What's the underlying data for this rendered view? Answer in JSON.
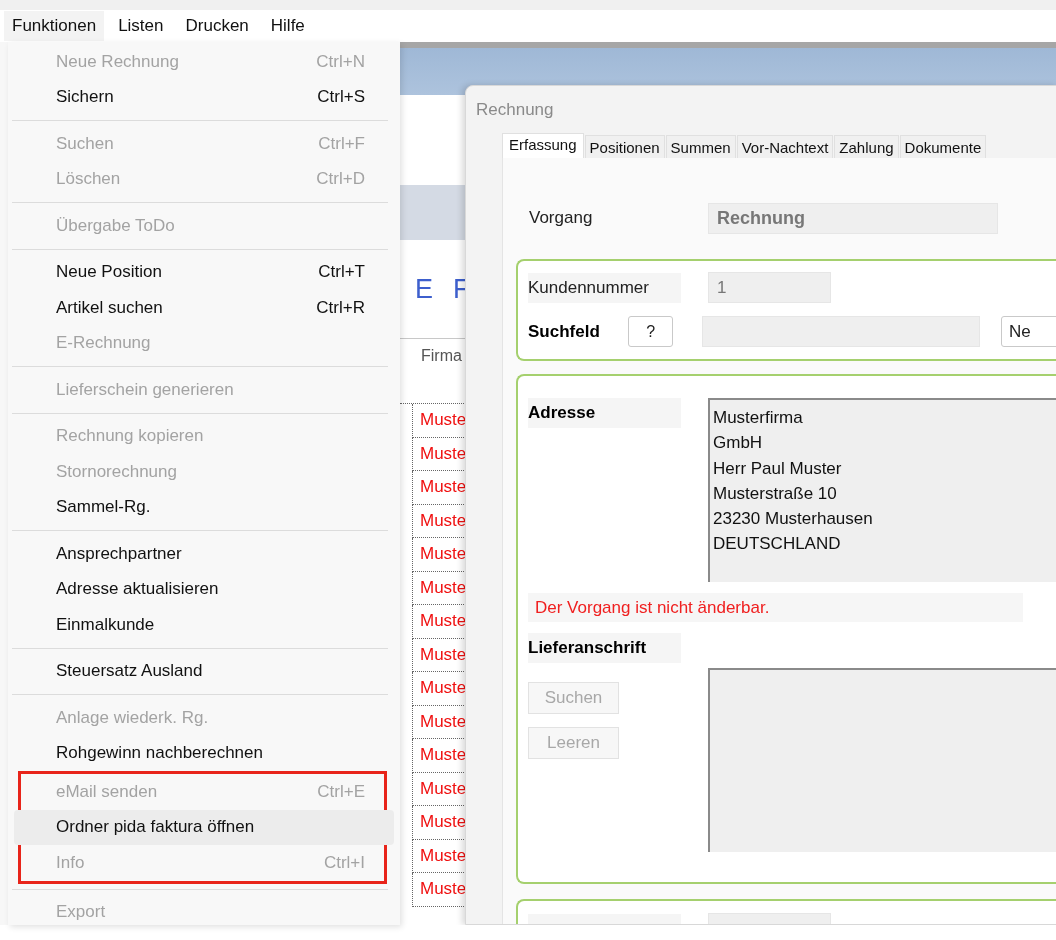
{
  "menubar": [
    {
      "label": "Funktionen",
      "selected": true
    },
    {
      "label": "Listen",
      "selected": false
    },
    {
      "label": "Drucken",
      "selected": false
    },
    {
      "label": "Hilfe",
      "selected": false
    }
  ],
  "menu": {
    "items": [
      {
        "kind": "item",
        "label": "Neue Rechnung",
        "shortcut": "Ctrl+N",
        "disabled": true,
        "selected": false,
        "framed": false
      },
      {
        "kind": "item",
        "label": "Sichern",
        "shortcut": "Ctrl+S",
        "disabled": false,
        "selected": false,
        "framed": false
      },
      {
        "kind": "separator"
      },
      {
        "kind": "item",
        "label": "Suchen",
        "shortcut": "Ctrl+F",
        "disabled": true,
        "selected": false,
        "framed": false
      },
      {
        "kind": "item",
        "label": "Löschen",
        "shortcut": "Ctrl+D",
        "disabled": true,
        "selected": false,
        "framed": false
      },
      {
        "kind": "separator"
      },
      {
        "kind": "item",
        "label": "Übergabe ToDo",
        "disabled": true,
        "selected": false,
        "framed": false
      },
      {
        "kind": "separator"
      },
      {
        "kind": "item",
        "label": "Neue Position",
        "shortcut": "Ctrl+T",
        "disabled": false,
        "selected": false,
        "framed": false
      },
      {
        "kind": "item",
        "label": "Artikel suchen",
        "shortcut": "Ctrl+R",
        "disabled": false,
        "selected": false,
        "framed": false
      },
      {
        "kind": "item",
        "label": "E-Rechnung",
        "disabled": true,
        "selected": false,
        "framed": false
      },
      {
        "kind": "separator"
      },
      {
        "kind": "item",
        "label": "Lieferschein generieren",
        "disabled": true,
        "selected": false,
        "framed": false
      },
      {
        "kind": "separator"
      },
      {
        "kind": "item",
        "label": "Rechnung kopieren",
        "disabled": true,
        "selected": false,
        "framed": false
      },
      {
        "kind": "item",
        "label": "Stornorechnung",
        "disabled": true,
        "selected": false,
        "framed": false
      },
      {
        "kind": "item",
        "label": "Sammel-Rg.",
        "disabled": false,
        "selected": false,
        "framed": false
      },
      {
        "kind": "separator"
      },
      {
        "kind": "item",
        "label": "Ansprechpartner",
        "disabled": false,
        "selected": false,
        "framed": false
      },
      {
        "kind": "item",
        "label": "Adresse aktualisieren",
        "disabled": false,
        "selected": false,
        "framed": false
      },
      {
        "kind": "item",
        "label": "Einmalkunde",
        "disabled": false,
        "selected": false,
        "framed": false
      },
      {
        "kind": "separator"
      },
      {
        "kind": "item",
        "label": "Steuersatz Ausland",
        "disabled": false,
        "selected": false,
        "framed": false
      },
      {
        "kind": "separator"
      },
      {
        "kind": "item",
        "label": "Anlage wiederk. Rg.",
        "disabled": true,
        "selected": false,
        "framed": false
      },
      {
        "kind": "item",
        "label": "Rohgewinn nachberechnen",
        "disabled": false,
        "selected": false,
        "framed": false
      },
      {
        "kind": "item",
        "label": "eMail senden",
        "shortcut": "Ctrl+E",
        "disabled": true,
        "selected": false,
        "framed": true
      },
      {
        "kind": "item",
        "label": "Ordner pida faktura öffnen",
        "disabled": false,
        "selected": true,
        "framed": true
      },
      {
        "kind": "item",
        "label": "Info",
        "shortcut": "Ctrl+I",
        "disabled": true,
        "selected": false,
        "framed": true
      },
      {
        "kind": "separator"
      },
      {
        "kind": "item",
        "label": "Export",
        "disabled": true,
        "selected": false,
        "framed": false
      }
    ]
  },
  "background": {
    "letters": [
      "E",
      "F"
    ],
    "table": {
      "columns": [
        "Firma"
      ],
      "rows": [
        "Muste",
        "Muste",
        "Muste",
        "Muste",
        "Muste",
        "Muste",
        "Muste",
        "Muste",
        "Muste",
        "Muste",
        "Muste",
        "Muste",
        "Muste",
        "Muste",
        "Muste"
      ]
    }
  },
  "dialog": {
    "title": "Rechnung",
    "tabs": [
      {
        "label": "Erfassung",
        "selected": true
      },
      {
        "label": "Positionen",
        "selected": false
      },
      {
        "label": "Summen",
        "selected": false
      },
      {
        "label": "Vor-Nachtext",
        "selected": false
      },
      {
        "label": "Zahlung",
        "selected": false
      },
      {
        "label": "Dokumente",
        "selected": false
      }
    ],
    "vorgang": {
      "label": "Vorgang",
      "value": "Rechnung"
    },
    "kundennummer": {
      "label": "Kundennummer",
      "value": "1"
    },
    "suchfeld": {
      "label": "Suchfeld",
      "help_button": "?",
      "new_button": "Ne"
    },
    "adresse": {
      "label": "Adresse",
      "lines": [
        "Musterfirma",
        "GmbH",
        "Herr Paul Muster",
        "Musterstraße 10",
        "23230 Musterhausen",
        "DEUTSCHLAND"
      ]
    },
    "message": "Der Vorgang ist nicht änderbar.",
    "lieferanschrift": {
      "label": "Lieferanschrift",
      "buttons": [
        {
          "label": "Suchen",
          "disabled": true
        },
        {
          "label": "Leeren",
          "disabled": true
        }
      ]
    }
  }
}
